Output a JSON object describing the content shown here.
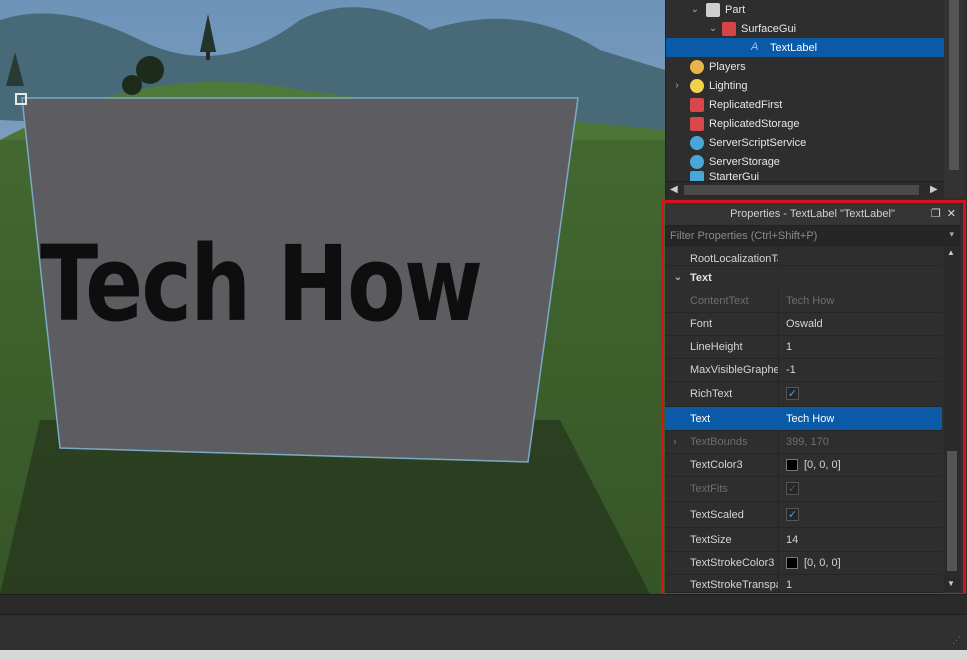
{
  "viewport": {
    "sign_text": "Tech How"
  },
  "explorer": {
    "items": [
      {
        "label": "Part",
        "icon": "part-icon",
        "expanded": true
      },
      {
        "label": "SurfaceGui",
        "icon": "surfacegui-icon",
        "expanded": true
      },
      {
        "label": "TextLabel",
        "icon": "textlabel-icon",
        "selected": true
      },
      {
        "label": "Players",
        "icon": "players-icon"
      },
      {
        "label": "Lighting",
        "icon": "lighting-icon",
        "collapsed": true
      },
      {
        "label": "ReplicatedFirst",
        "icon": "replicatedfirst-icon"
      },
      {
        "label": "ReplicatedStorage",
        "icon": "replicatedstorage-icon"
      },
      {
        "label": "ServerScriptService",
        "icon": "serverscriptservice-icon"
      },
      {
        "label": "ServerStorage",
        "icon": "serverstorage-icon"
      },
      {
        "label": "StarterGui",
        "icon": "startergui-icon"
      }
    ]
  },
  "properties": {
    "title": "Properties - TextLabel \"TextLabel\"",
    "filter_placeholder": "Filter Properties (Ctrl+Shift+P)",
    "top_row_name": "RootLocalizationTa...",
    "section_label": "Text",
    "rows": [
      {
        "name": "ContentText",
        "value": "Tech How",
        "dim": true
      },
      {
        "name": "Font",
        "value": "Oswald"
      },
      {
        "name": "LineHeight",
        "value": "1"
      },
      {
        "name": "MaxVisibleGraphemes",
        "value": "-1"
      },
      {
        "name": "RichText",
        "type": "checkbox",
        "checked": true
      },
      {
        "name": "Text",
        "value": "Tech How",
        "selected": true
      },
      {
        "name": "TextBounds",
        "value": "399, 170",
        "dim": true,
        "expandable": true
      },
      {
        "name": "TextColor3",
        "value": "[0, 0, 0]",
        "swatch": "#000000"
      },
      {
        "name": "TextFits",
        "type": "checkbox",
        "checked": true,
        "dim": true
      },
      {
        "name": "TextScaled",
        "type": "checkbox",
        "checked": true
      },
      {
        "name": "TextSize",
        "value": "14"
      },
      {
        "name": "TextStrokeColor3",
        "value": "[0, 0, 0]",
        "swatch": "#000000"
      },
      {
        "name": "TextStrokeTranspar...",
        "value": "1"
      }
    ]
  },
  "colors": {
    "selection": "#0b5aa8",
    "highlight_box": "#d4131d",
    "panel_bg": "#2e2e2e"
  }
}
